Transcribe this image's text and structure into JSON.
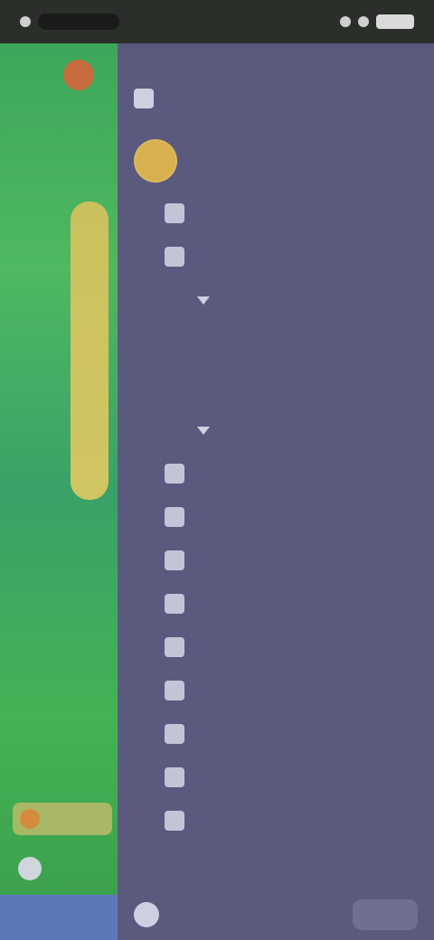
{
  "status": {
    "time": "",
    "battery_label": ""
  },
  "drawer": {
    "top_label": "",
    "title": "",
    "subtitle": "",
    "user_name": "",
    "menu": [
      {
        "label": "",
        "level": 1
      },
      {
        "label": "",
        "level": 1
      },
      {
        "label": "",
        "level": 2
      },
      {
        "label": "",
        "level": 3
      },
      {
        "label": "",
        "level": 3
      },
      {
        "label": "",
        "level": 2
      },
      {
        "label": "",
        "level": 1
      },
      {
        "label": "",
        "level": 1
      },
      {
        "label": "",
        "level": 1
      },
      {
        "label": "",
        "level": 1
      },
      {
        "label": "",
        "level": 1
      },
      {
        "label": "",
        "level": 1
      },
      {
        "label": "",
        "level": 1
      },
      {
        "label": "",
        "level": 1
      },
      {
        "label": "",
        "level": 1
      }
    ],
    "bottom_action": ""
  },
  "colors": {
    "drawer_bg": "#5a5a7f",
    "map_green": "#44b255",
    "road_yellow": "#e1c963",
    "map_bottom_blue": "#5d78b8"
  }
}
